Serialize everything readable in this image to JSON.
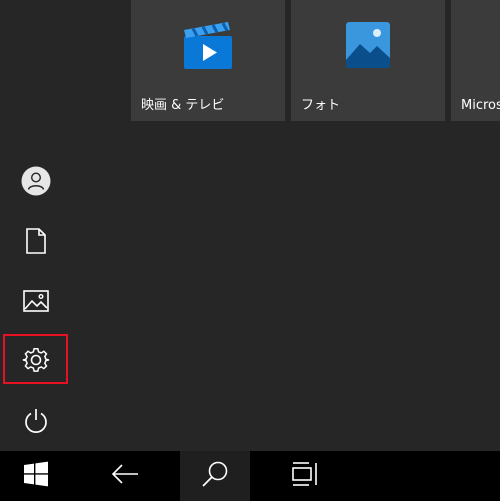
{
  "tiles": [
    {
      "label": "映画 & テレビ",
      "icon": "movies-tv-icon"
    },
    {
      "label": "フォト",
      "icon": "photos-icon"
    },
    {
      "label": "Microsoft",
      "icon": "microsoft-icon"
    }
  ],
  "rail": {
    "items": [
      {
        "name": "user-account",
        "icon": "user-icon"
      },
      {
        "name": "documents",
        "icon": "document-icon"
      },
      {
        "name": "pictures",
        "icon": "picture-icon"
      },
      {
        "name": "settings",
        "icon": "gear-icon",
        "highlighted": true
      },
      {
        "name": "power",
        "icon": "power-icon"
      }
    ]
  },
  "taskbar": {
    "items": [
      {
        "name": "start",
        "icon": "windows-logo-icon"
      },
      {
        "name": "back",
        "icon": "back-arrow-icon"
      },
      {
        "name": "search",
        "icon": "search-icon",
        "active": true
      },
      {
        "name": "task-view",
        "icon": "task-view-icon"
      }
    ]
  },
  "colors": {
    "background": "#262626",
    "tile": "#3b3b3b",
    "taskbar": "#000000",
    "highlight": "#e81123"
  }
}
